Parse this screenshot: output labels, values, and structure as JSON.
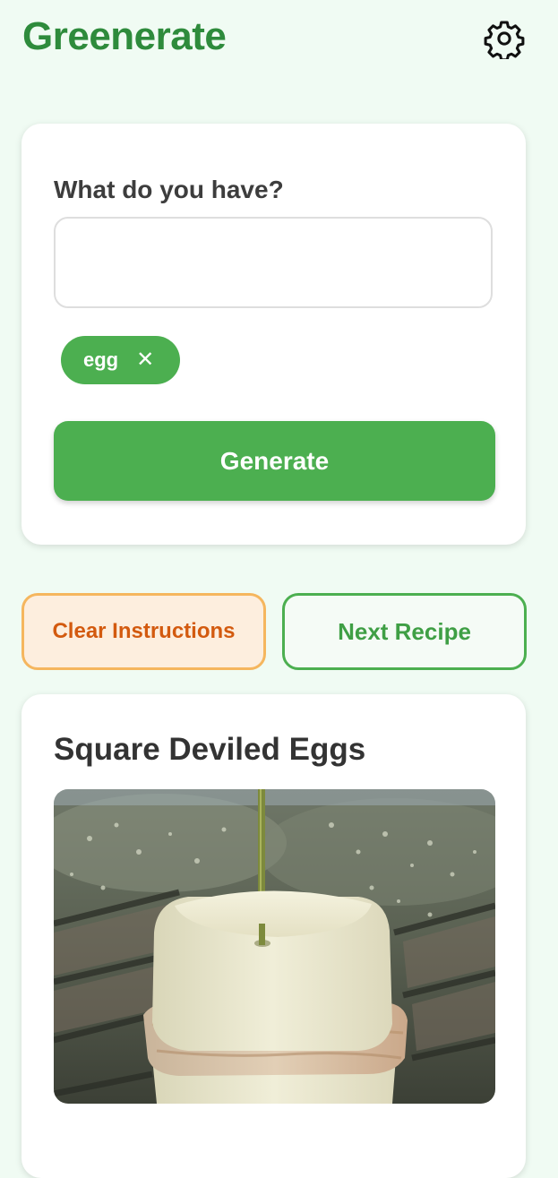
{
  "header": {
    "app_title": "Greenerate",
    "settings_icon": "gear-icon"
  },
  "input_card": {
    "label": "What do you have?",
    "input_value": "",
    "input_placeholder": "",
    "chips": [
      {
        "label": "egg",
        "remove_icon": "close-icon",
        "remove_glyph": "✕"
      }
    ],
    "generate_label": "Generate"
  },
  "actions": {
    "clear_label": "Clear Instructions",
    "next_label": "Next Recipe"
  },
  "recipe": {
    "title": "Square Deviled Eggs"
  },
  "colors": {
    "brand_green": "#4caf50",
    "title_green": "#2e8b3c",
    "background": "#f0fbf3",
    "clear_text": "#d35a0f",
    "clear_border": "#f5b65e",
    "clear_fill": "#fdeede"
  }
}
